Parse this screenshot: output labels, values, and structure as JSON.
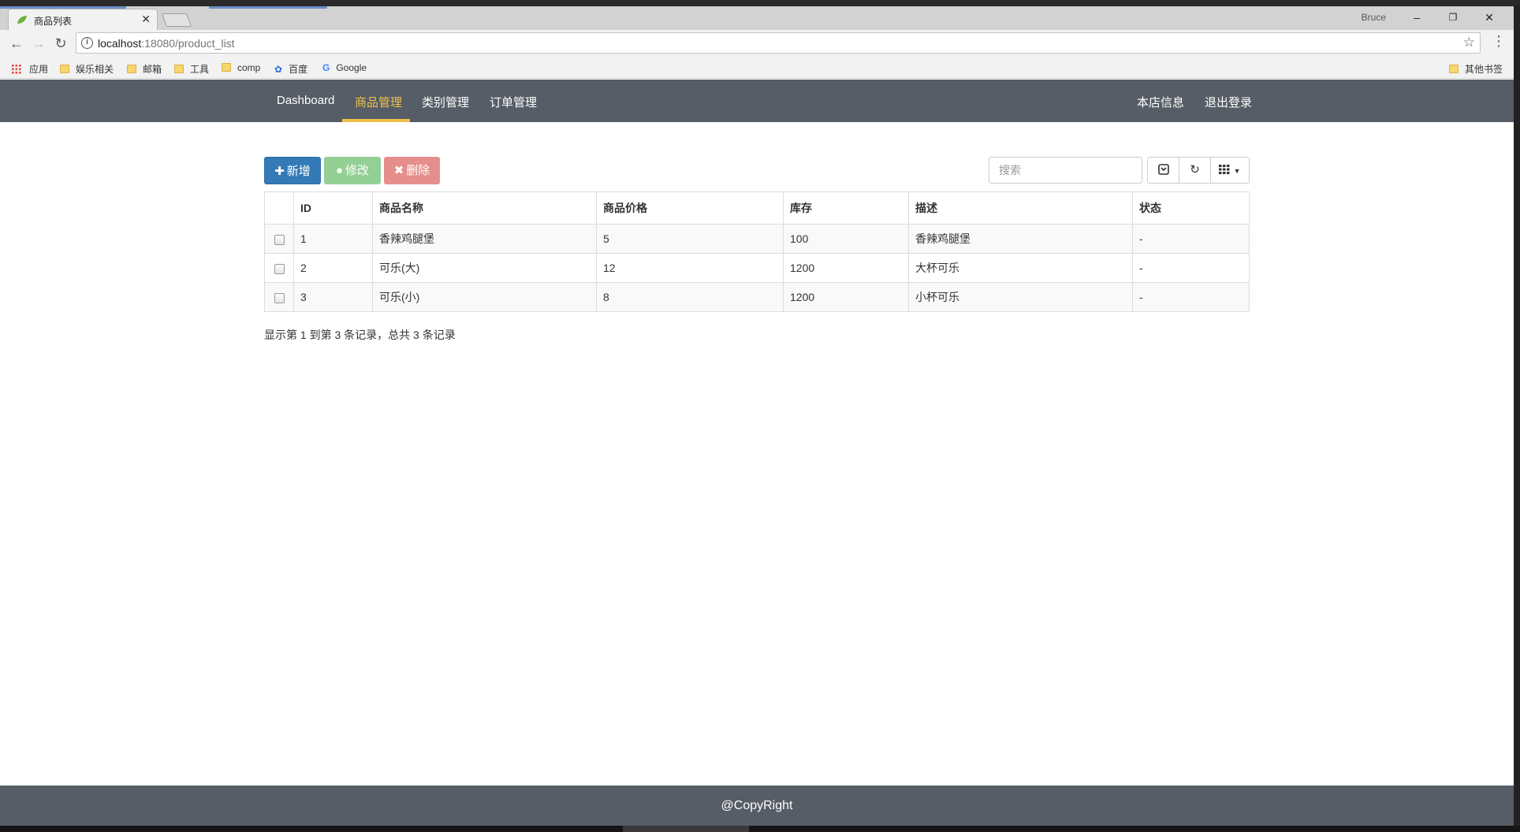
{
  "browser": {
    "tab_title": "商品列表",
    "tab_close": "✕",
    "profile_name": "Bruce",
    "window_controls": {
      "minimize": "–",
      "restore": "❐",
      "close": "✕"
    },
    "url_host": "localhost",
    "url_path": ":18080/product_list",
    "info_icon": "i",
    "star_icon": "☆",
    "menu_icon": "⋮",
    "nav": {
      "back": "←",
      "forward": "→",
      "reload": "↻"
    },
    "bookmarks": [
      {
        "label": "应用",
        "icon": "apps-icon"
      },
      {
        "label": "娱乐相关",
        "icon": "folder-icon"
      },
      {
        "label": "邮箱",
        "icon": "folder-icon"
      },
      {
        "label": "工具",
        "icon": "folder-icon"
      },
      {
        "label": "comp",
        "icon": "folder-icon"
      },
      {
        "label": "百度",
        "icon": "baidu-paw-icon"
      },
      {
        "label": "Google",
        "icon": "google-icon"
      }
    ],
    "other_bookmarks": "其他书签"
  },
  "navbar": {
    "links": [
      "Dashboard",
      "商品管理",
      "类别管理",
      "订单管理"
    ],
    "active": "商品管理",
    "right_links": [
      "本店信息",
      "退出登录"
    ],
    "accent_color": "#f0c04a",
    "bg_color": "#565d66"
  },
  "toolbar": {
    "add_label": "新增",
    "edit_label": "修改",
    "delete_label": "删除",
    "search_placeholder": "搜索",
    "toggle_icon": "toggle-view-icon",
    "refresh_icon": "refresh-icon",
    "columns_icon": "columns-grid-icon"
  },
  "table": {
    "headers": [
      "ID",
      "商品名称",
      "商品价格",
      "库存",
      "描述",
      "状态"
    ],
    "rows": [
      {
        "id": "1",
        "name": "香辣鸡腿堡",
        "price": "5",
        "stock": "100",
        "desc": "香辣鸡腿堡",
        "status": "-"
      },
      {
        "id": "2",
        "name": "可乐(大)",
        "price": "12",
        "stock": "1200",
        "desc": "大杯可乐",
        "status": "-"
      },
      {
        "id": "3",
        "name": "可乐(小)",
        "price": "8",
        "stock": "1200",
        "desc": "小杯可乐",
        "status": "-"
      }
    ]
  },
  "pagination_info": "显示第 1 到第 3 条记录，总共 3 条记录",
  "footer": "@CopyRight"
}
